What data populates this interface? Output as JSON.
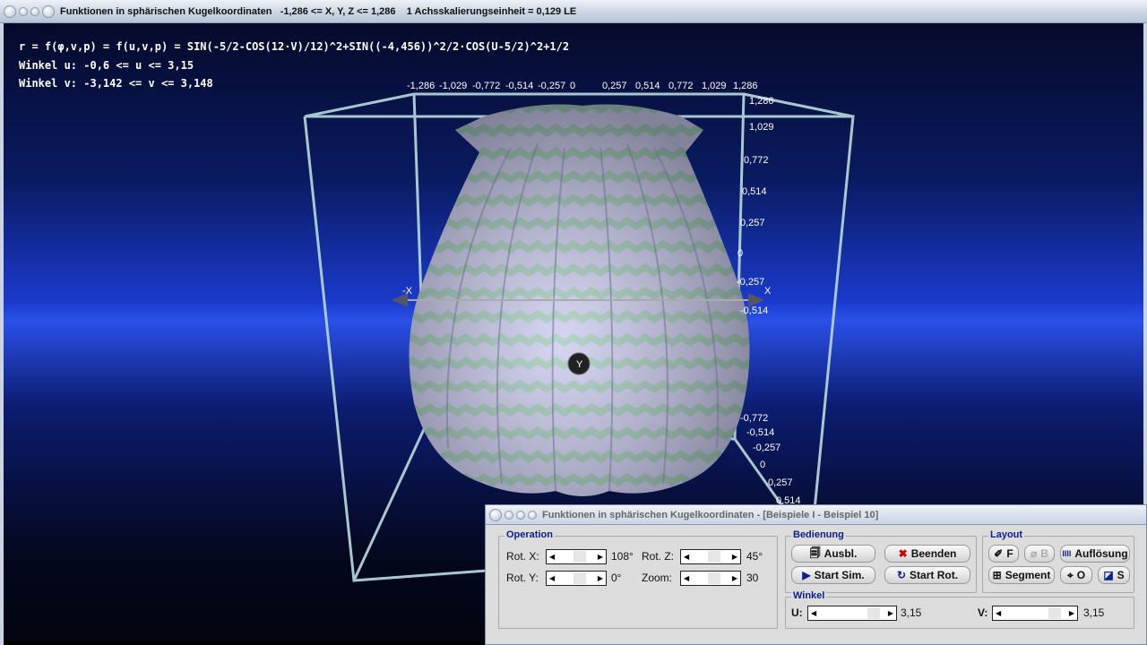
{
  "main_window": {
    "title": "Funktionen in sphärischen Kugelkoordinaten   -1,286 <= X, Y, Z <= 1,286    1 Achsskalierungseinheit = 0,129 LE"
  },
  "info": {
    "formula": "r = f(φ,v,p) = f(u,v,p) = SIN(-5/2-COS(12·V)/12)^2+SIN((-4,456))^2/2·COS(U-5/2)^2+1/2",
    "range_u": "Winkel u: -0,6 <= u <= 3,15",
    "range_v": "Winkel v: -3,142 <= v <= 3,148"
  },
  "axes": {
    "x_ticks": [
      "-1,286",
      "-1,029",
      "-0,772",
      "-0,514",
      "-0,257",
      "0",
      "0,257",
      "0,514",
      "0,772",
      "1,029",
      "1,286"
    ],
    "z_ticks": [
      "1,286",
      "1,029",
      "0,772",
      "0,514",
      "0,257",
      "0",
      "-0,257",
      "-0,514"
    ],
    "y_ticks": [
      "-0,772",
      "-0,514",
      "-0,257",
      "0",
      "0,257",
      "0,514"
    ],
    "label_x": "X",
    "label_negx": "-X",
    "label_y": "Y"
  },
  "colors": {
    "surface_stripe_a": "#c8c8ee",
    "surface_stripe_b": "#9ec8b8",
    "box": "#a8c8d0"
  },
  "panel": {
    "title": "Funktionen in sphärischen Kugelkoordinaten - [Beispiele I - Beispiel 10]",
    "operation": {
      "legend": "Operation",
      "rot_x_label": "Rot. X:",
      "rot_x_value": "108°",
      "rot_z_label": "Rot. Z:",
      "rot_z_value": "45°",
      "rot_y_label": "Rot. Y:",
      "rot_y_value": "0°",
      "zoom_label": "Zoom:",
      "zoom_value": "30"
    },
    "bedienung": {
      "legend": "Bedienung",
      "ausbl": "Ausbl.",
      "beenden": "Beenden",
      "start_sim": "Start Sim.",
      "start_rot": "Start Rot."
    },
    "layout": {
      "legend": "Layout",
      "f": "F",
      "b": "B",
      "aufloesung": "Auflösung",
      "segment": "Segment",
      "o": "O",
      "s": "S"
    },
    "winkel": {
      "legend": "Winkel",
      "u_label": "U:",
      "u_value": "3,15",
      "v_label": "V:",
      "v_value": "3,15"
    }
  }
}
